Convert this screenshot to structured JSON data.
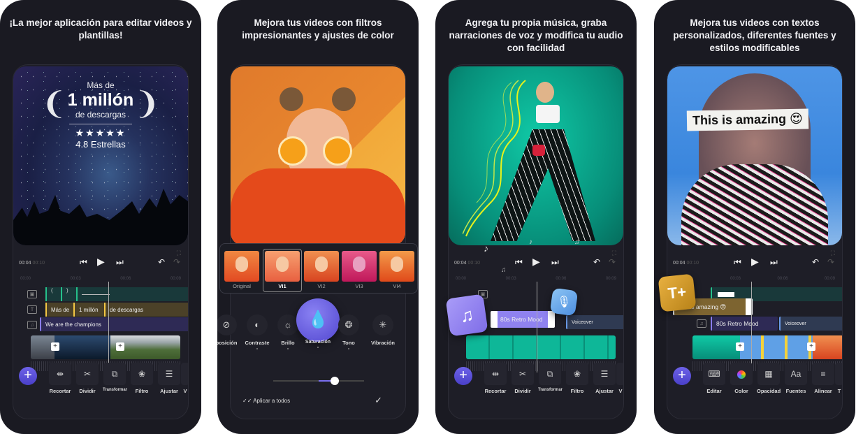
{
  "cards": [
    {
      "headline": "¡La mejor aplicación para editar videos y plantillas!",
      "award": {
        "prefix": "Más de",
        "main": "1 millón",
        "suffix": "de descargas",
        "stars": "★★★★★",
        "rating": "4.8 Estrellas"
      },
      "player": {
        "current": "00:04",
        "total": "00:10",
        "ruler": [
          "00:00",
          "00:03",
          "00:06",
          "00:09"
        ]
      },
      "tracks": {
        "text_segments": [
          "Más de",
          "1 millón",
          "de descargas"
        ],
        "music": "We are the champions"
      },
      "tools": [
        "Recortar",
        "Dividir",
        "Transformar",
        "Filtro",
        "Ajustar",
        "V"
      ]
    },
    {
      "headline": "Mejora tus videos con filtros impresionantes y ajustes de color",
      "filters": [
        "Original",
        "VI1",
        "VI2",
        "VI3",
        "VI4"
      ],
      "selected_filter": "VI1",
      "adjustments": [
        "posición",
        "Contraste",
        "Brillo",
        "Saturación",
        "Tono",
        "Vibración"
      ],
      "selected_adjustment": "Saturación",
      "slider_value": 0.68,
      "apply_all": "Aplicar a todos"
    },
    {
      "headline": "Agrega tu propia música, graba narraciones de voz y modifica tu audio con facilidad",
      "player": {
        "current": "00:04",
        "total": "00:10",
        "ruler": [
          "00:00",
          "00:03",
          "00:06",
          "00:09"
        ]
      },
      "tracks": {
        "music": "80s Retro Mood",
        "voice": "Voiceover"
      },
      "tools": [
        "Recortar",
        "Dividir",
        "Transformar",
        "Filtro",
        "Ajustar",
        "V"
      ]
    },
    {
      "headline": "Mejora tus videos con textos personalizados, diferentes fuentes y estilos modificables",
      "overlay_text": "This is amazing 😍",
      "player": {
        "current": "00:04",
        "total": "00:10",
        "ruler": [
          "00:03",
          "00:06",
          "00:09"
        ]
      },
      "tracks": {
        "text": "This is amazing 😍",
        "music": "80s Retro Mood",
        "voice": "Voiceover"
      },
      "tools": [
        "Editar",
        "Color",
        "Opacidad",
        "Fuentes",
        "Alinear",
        "T"
      ]
    }
  ],
  "colors": {
    "accent": "#5a4fe0",
    "background": "#1a1a22",
    "text_track": "#6b5a2c",
    "music_track": "#3c3670",
    "voice_track": "#2f3a52"
  }
}
